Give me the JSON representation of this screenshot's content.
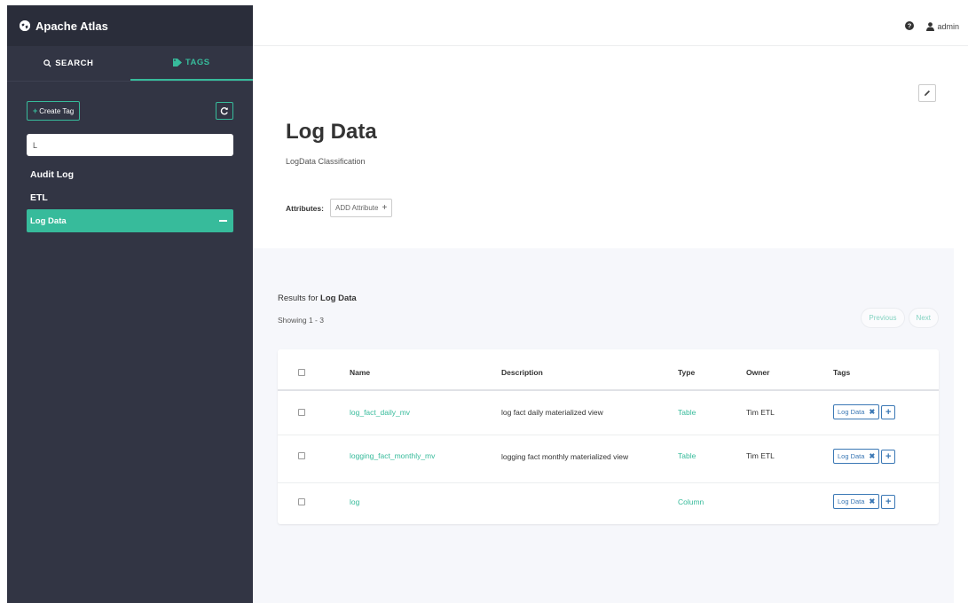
{
  "app": {
    "brand": "Apache Atlas"
  },
  "sidebar": {
    "tabs": [
      {
        "label": "SEARCH"
      },
      {
        "label": "TAGS"
      }
    ],
    "create_tag_label": "Create Tag",
    "search_value": "L",
    "items": [
      {
        "label": "Audit Log"
      },
      {
        "label": "ETL"
      },
      {
        "label": "Log Data"
      }
    ]
  },
  "header": {
    "user": "admin"
  },
  "details": {
    "title": "Log Data",
    "subtitle": "LogData Classification",
    "attributes_label": "Attributes:",
    "add_attribute_label": "ADD Attribute"
  },
  "results": {
    "prefix": "Results for ",
    "tag": "Log Data",
    "showing": "Showing 1 - 3",
    "previous": "Previous",
    "next": "Next",
    "columns": [
      "Name",
      "Description",
      "Type",
      "Owner",
      "Tags"
    ],
    "rows": [
      {
        "name": "log_fact_daily_mv",
        "description": "log fact daily materialized view",
        "type": "Table",
        "owner": "Tim ETL",
        "tag": "Log Data"
      },
      {
        "name": "logging_fact_monthly_mv",
        "description": "logging fact monthly materialized view",
        "type": "Table",
        "owner": "Tim ETL",
        "tag": "Log Data"
      },
      {
        "name": "log",
        "description": "",
        "type": "Column",
        "owner": "",
        "tag": "Log Data"
      }
    ]
  },
  "colors": {
    "accent": "#37bb9b",
    "sidebar_bg": "#323544",
    "tag_blue": "#3b78b5"
  },
  "icons": [
    "globe-icon",
    "search-icon",
    "tag-icon",
    "refresh-icon",
    "help-icon",
    "user-icon",
    "pencil-icon",
    "close-icon",
    "plus-icon",
    "minus-icon"
  ]
}
